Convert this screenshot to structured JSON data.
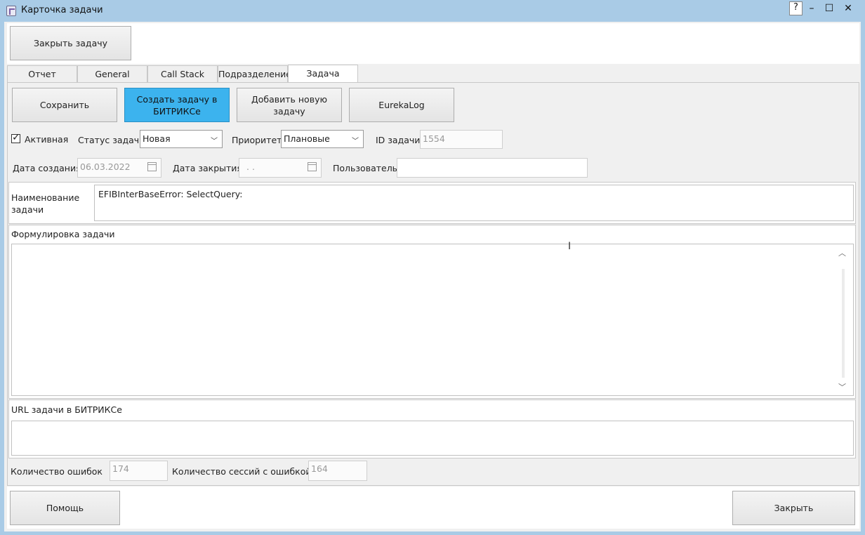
{
  "window": {
    "title": "Карточка задачи",
    "help": "?",
    "minimize": "–",
    "maximize": "☐",
    "close": "✕"
  },
  "toolbar": {
    "close_task": "Закрыть задачу"
  },
  "tabs": [
    "Отчет",
    "General",
    "Call Stack",
    "Подразделение",
    "Задача"
  ],
  "active_tab": "Задача",
  "actions": {
    "save": "Сохранить",
    "create_bitrix": "Создать задачу в БИТРИКСе",
    "add_new": "Добавить новую задачу",
    "eurekalog": "EurekaLog"
  },
  "form": {
    "active_label": "Активная",
    "active_checked": true,
    "status_label": "Статус задачи",
    "status_value": "Новая",
    "priority_label": "Приоритет",
    "priority_value": "Плановые",
    "id_label": "ID задачи",
    "id_value": "1554",
    "created_label": "Дата создания",
    "created_value": "06.03.2022",
    "closed_label": "Дата закрытия",
    "closed_value": " .  .",
    "user_label": "Пользователь",
    "user_value": "",
    "name_label": "Наименование задачи",
    "name_value": "EFIBInterBaseError: SelectQuery:",
    "description_label": "Формулировка задачи",
    "description_value": "",
    "url_label": "URL задачи в БИТРИКСе",
    "url_value": "",
    "errors_label": "Количество ошибок",
    "errors_value": "174",
    "sessions_label": "Количество сессий с ошибкой",
    "sessions_value": "164"
  },
  "footer": {
    "help": "Помощь",
    "close": "Закрыть"
  }
}
